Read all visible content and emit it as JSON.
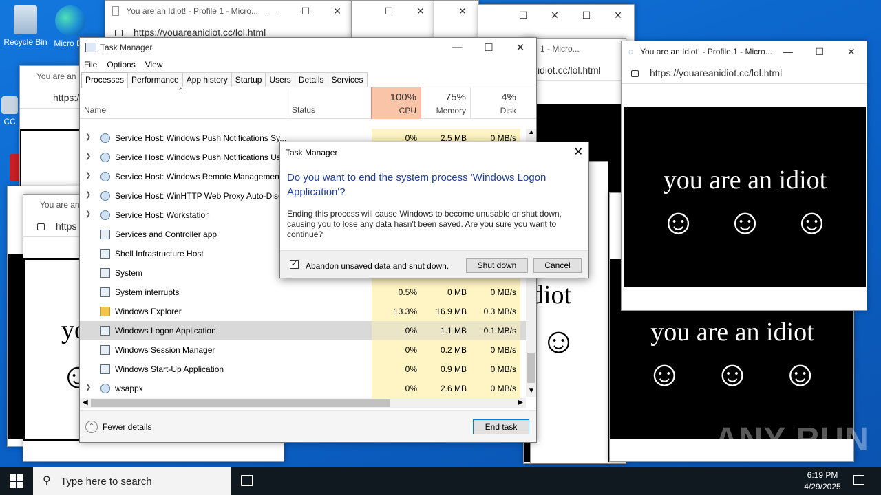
{
  "desktop": {
    "icons": [
      {
        "label": "Recycle Bin"
      },
      {
        "label": "Micro Ed"
      },
      {
        "label": "CC"
      }
    ]
  },
  "browser": {
    "title": "You are an Idiot! - Profile 1 - Micro...",
    "title_short": "You are an Idiot! - Profile 1 - Micro...",
    "url": "https://youareanidiot.cc/lol.html",
    "frag_title": "You are an I",
    "frag_url": "https:/",
    "frag_url2": "https",
    "frag_url3": "idiot.cc/lol.html",
    "frag_title2": "1 - Micro...",
    "frag_title3": "You are an",
    "idiot_text": "you are an idiot",
    "idiot_frag": "diot",
    "idiot_frag2": "yo",
    "idiot_frag3": "di",
    "face": "☺"
  },
  "taskmgr": {
    "title": "Task Manager",
    "menu": [
      "File",
      "Options",
      "View"
    ],
    "tabs": [
      "Processes",
      "Performance",
      "App history",
      "Startup",
      "Users",
      "Details",
      "Services"
    ],
    "columns": {
      "name": "Name",
      "status": "Status",
      "cpu_pct": "100%",
      "cpu": "CPU",
      "mem_pct": "75%",
      "mem": "Memory",
      "disk_pct": "4%",
      "disk": "Disk"
    },
    "rows": [
      {
        "name": "Service Host: Windows Push Notifications Sy...",
        "cpu": "0%",
        "mem": "2.5 MB",
        "disk": "0 MB/s",
        "exp": true,
        "icon": "gear"
      },
      {
        "name": "Service Host: Windows Push Notifications Us...",
        "cpu": "",
        "mem": "",
        "disk": "",
        "exp": true,
        "icon": "gear"
      },
      {
        "name": "Service Host: Windows Remote Managemen...",
        "cpu": "",
        "mem": "",
        "disk": "",
        "exp": true,
        "icon": "gear"
      },
      {
        "name": "Service Host: WinHTTP Web Proxy Auto-Disc...",
        "cpu": "",
        "mem": "",
        "disk": "",
        "exp": true,
        "icon": "gear"
      },
      {
        "name": "Service Host: Workstation",
        "cpu": "",
        "mem": "",
        "disk": "",
        "exp": true,
        "icon": "gear"
      },
      {
        "name": "Services and Controller app",
        "cpu": "",
        "mem": "",
        "disk": "",
        "exp": false,
        "icon": "app"
      },
      {
        "name": "Shell Infrastructure Host",
        "cpu": "",
        "mem": "",
        "disk": "",
        "exp": false,
        "icon": "app"
      },
      {
        "name": "System",
        "cpu": "",
        "mem": "",
        "disk": "",
        "exp": false,
        "icon": "app"
      },
      {
        "name": "System interrupts",
        "cpu": "0.5%",
        "mem": "0 MB",
        "disk": "0 MB/s",
        "exp": false,
        "icon": "app"
      },
      {
        "name": "Windows Explorer",
        "cpu": "13.3%",
        "mem": "16.9 MB",
        "disk": "0.3 MB/s",
        "exp": false,
        "icon": "folder"
      },
      {
        "name": "Windows Logon Application",
        "cpu": "0%",
        "mem": "1.1 MB",
        "disk": "0.1 MB/s",
        "exp": false,
        "icon": "app",
        "selected": true
      },
      {
        "name": "Windows Session Manager",
        "cpu": "0%",
        "mem": "0.2 MB",
        "disk": "0 MB/s",
        "exp": false,
        "icon": "app"
      },
      {
        "name": "Windows Start-Up Application",
        "cpu": "0%",
        "mem": "0.9 MB",
        "disk": "0 MB/s",
        "exp": false,
        "icon": "app"
      },
      {
        "name": "wsappx",
        "cpu": "0%",
        "mem": "2.6 MB",
        "disk": "0 MB/s",
        "exp": true,
        "icon": "gear"
      }
    ],
    "fewer_details": "Fewer details",
    "end_task": "End task"
  },
  "dialog": {
    "title": "Task Manager",
    "heading": "Do you want to end the system process 'Windows Logon Application'?",
    "body": "Ending this process will cause Windows to become unusable or shut down, causing you to lose any data hasn't been saved. Are you sure you want to continue?",
    "checkbox_label": "Abandon unsaved data and shut down.",
    "checkbox_checked": true,
    "shutdown": "Shut down",
    "cancel": "Cancel"
  },
  "taskbar": {
    "search_placeholder": "Type here to search",
    "time": "6:19 PM",
    "date": "4/29/2025"
  },
  "watermark": "ANY RUN"
}
